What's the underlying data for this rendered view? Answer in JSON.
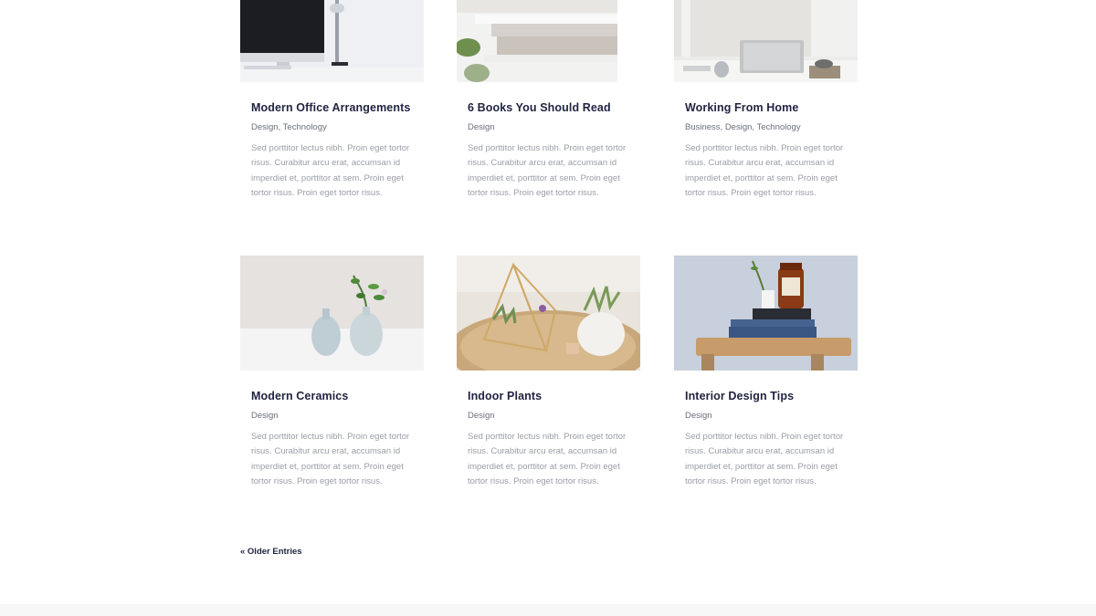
{
  "posts": [
    {
      "title": "Modern Office Arrangements",
      "categories": "Design, Technology",
      "excerpt": "Sed porttitor lectus nibh. Proin eget tortor risus. Curabitur arcu erat, accumsan id imperdiet et, porttitor at sem. Proin eget tortor risus. Proin eget tortor risus.",
      "image": "office-desk-computer-image"
    },
    {
      "title": "6 Books You Should Read",
      "categories": "Design",
      "excerpt": "Sed porttitor lectus nibh. Proin eget tortor risus. Curabitur arcu erat, accumsan id imperdiet et, porttitor at sem. Proin eget tortor risus. Proin eget tortor risus.",
      "image": "stacked-books-image"
    },
    {
      "title": "Working From Home",
      "categories": "Business, Design, Technology",
      "excerpt": "Sed porttitor lectus nibh. Proin eget tortor risus. Curabitur arcu erat, accumsan id imperdiet et, porttitor at sem. Proin eget tortor risus. Proin eget tortor risus.",
      "image": "laptop-desk-image"
    },
    {
      "title": "Modern Ceramics",
      "categories": "Design",
      "excerpt": "Sed porttitor lectus nibh. Proin eget tortor risus. Curabitur arcu erat, accumsan id imperdiet et, porttitor at sem. Proin eget tortor risus. Proin eget tortor risus.",
      "image": "ceramic-vases-image"
    },
    {
      "title": "Indoor Plants",
      "categories": "Design",
      "excerpt": "Sed porttitor lectus nibh. Proin eget tortor risus. Curabitur arcu erat, accumsan id imperdiet et, porttitor at sem. Proin eget tortor risus. Proin eget tortor risus.",
      "image": "air-plants-terrarium-image"
    },
    {
      "title": "Interior Design Tips",
      "categories": "Design",
      "excerpt": "Sed porttitor lectus nibh. Proin eget tortor risus. Curabitur arcu erat, accumsan id imperdiet et, porttitor at sem. Proin eget tortor risus. Proin eget tortor risus.",
      "image": "stool-books-jar-image"
    }
  ],
  "pagination": {
    "older_label": "« Older Entries"
  }
}
